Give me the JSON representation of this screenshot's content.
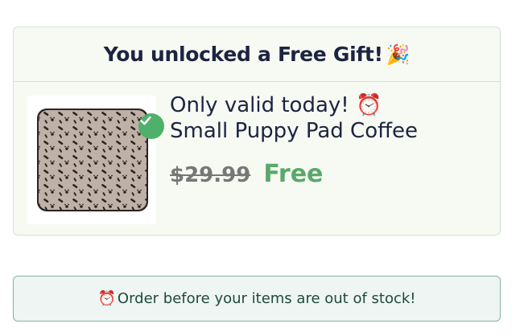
{
  "gift_card": {
    "title": "You unlocked a Free Gift!",
    "title_emoji": "🎉",
    "line1_text": "Only valid today!",
    "line1_emoji": "⏰",
    "product_name": "Small Puppy Pad Coffee",
    "original_price": "$29.99",
    "gift_price": "Free",
    "selected_icon": "check-icon",
    "colors": {
      "accent_green": "#5aa86a",
      "check_bg": "#4fb06a",
      "card_bg": "#f6faf3",
      "border": "#cfe6cf"
    }
  },
  "stock_banner": {
    "emoji": "⏰",
    "text": "Order before your items are out of stock!"
  }
}
